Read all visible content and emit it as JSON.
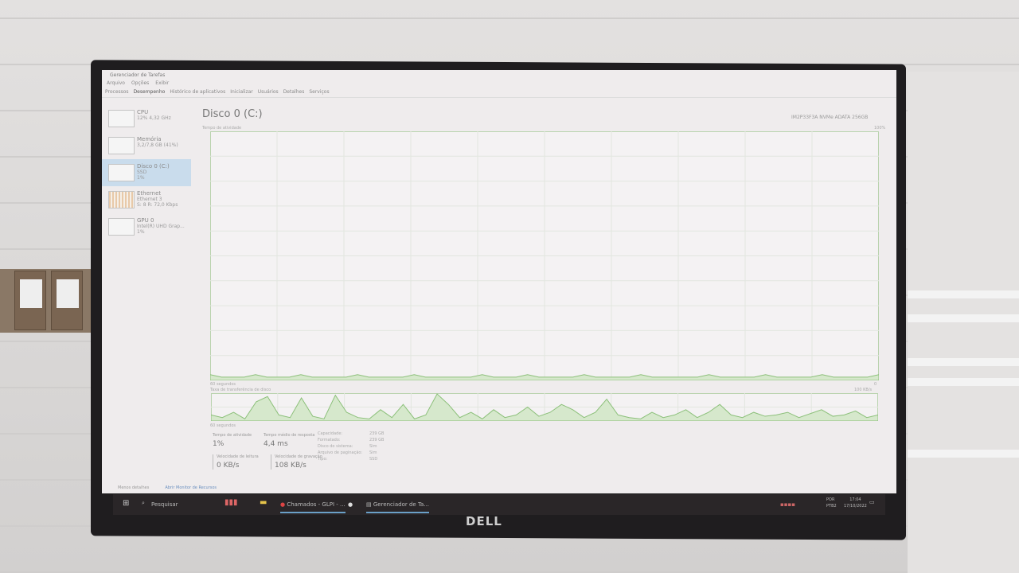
{
  "window": {
    "title": "Gerenciador de Tarefas"
  },
  "menu": [
    "Arquivo",
    "Opções",
    "Exibir"
  ],
  "tabs": [
    {
      "label": "Processos"
    },
    {
      "label": "Desempenho",
      "active": true
    },
    {
      "label": "Histórico de aplicativos"
    },
    {
      "label": "Inicializar"
    },
    {
      "label": "Usuários"
    },
    {
      "label": "Detalhes"
    },
    {
      "label": "Serviços"
    }
  ],
  "sidebar": [
    {
      "name": "CPU",
      "line1": "12% 4,32 GHz",
      "line2": ""
    },
    {
      "name": "Memória",
      "line1": "3,2/7,8 GB (41%)",
      "line2": ""
    },
    {
      "name": "Disco 0 (C:)",
      "line1": "SSD",
      "line2": "1%",
      "selected": true
    },
    {
      "name": "Ethernet",
      "line1": "Ethernet 3",
      "line2": "S: 8 R: 72,0 Kbps"
    },
    {
      "name": "GPU 0",
      "line1": "Intel(R) UHD Grap...",
      "line2": "1%"
    }
  ],
  "main": {
    "title": "Disco 0 (C:)",
    "model": "IM2P33F3A NVMe ADATA 256GB",
    "chart1": {
      "label": "Tempo de atividade",
      "max": "100%",
      "time": "60 segundos",
      "min": "0",
      "values": [
        2,
        1,
        1,
        1,
        2,
        1,
        1,
        1,
        2,
        1,
        1,
        1,
        1,
        2,
        1,
        1,
        1,
        1,
        2,
        1,
        1,
        1,
        1,
        1,
        2,
        1,
        1,
        1,
        2,
        1,
        1,
        1,
        1,
        2,
        1,
        1,
        1,
        1,
        2,
        1,
        1,
        1,
        1,
        1,
        2,
        1,
        1,
        1,
        1,
        2,
        1,
        1,
        1,
        1,
        2,
        1,
        1,
        1,
        1,
        2
      ]
    },
    "chart2": {
      "label": "Taxa de transferência de disco",
      "max": "100 KB/s",
      "time": "60 segundos",
      "values": [
        20,
        10,
        30,
        5,
        70,
        90,
        20,
        10,
        85,
        15,
        5,
        95,
        30,
        10,
        5,
        40,
        10,
        60,
        5,
        20,
        100,
        60,
        10,
        30,
        5,
        40,
        10,
        20,
        50,
        15,
        30,
        60,
        40,
        10,
        30,
        80,
        20,
        10,
        5,
        30,
        10,
        20,
        40,
        10,
        30,
        60,
        20,
        10,
        30,
        15,
        20,
        30,
        10,
        25,
        40,
        15,
        20,
        35,
        10,
        20
      ]
    },
    "stats": [
      {
        "label": "Tempo de atividade",
        "value": "1%"
      },
      {
        "label": "Tempo médio de resposta",
        "value": "4,4 ms"
      },
      {
        "label": "Velocidade de leitura",
        "value": "0 KB/s"
      },
      {
        "label": "Velocidade de gravação",
        "value": "108 KB/s"
      }
    ],
    "properties": [
      {
        "k": "Capacidade:",
        "v": "239 GB"
      },
      {
        "k": "Formatado:",
        "v": "239 GB"
      },
      {
        "k": "Disco do sistema:",
        "v": "Sim"
      },
      {
        "k": "Arquivo de paginação:",
        "v": "Sim"
      },
      {
        "k": "Tipo:",
        "v": "SSD"
      }
    ],
    "accent": "#8cc07a"
  },
  "footer": {
    "less": "Menos detalhes",
    "monitor": "Abrir Monitor de Recursos"
  },
  "taskbar": {
    "search": "Pesquisar",
    "apps": [
      "Chamados - GLPI - ...",
      "Gerenciador de Ta..."
    ],
    "lang1": "POR",
    "lang2": "PTB2",
    "time": "17:04",
    "date": "17/10/2022"
  },
  "brand": "DELL"
}
